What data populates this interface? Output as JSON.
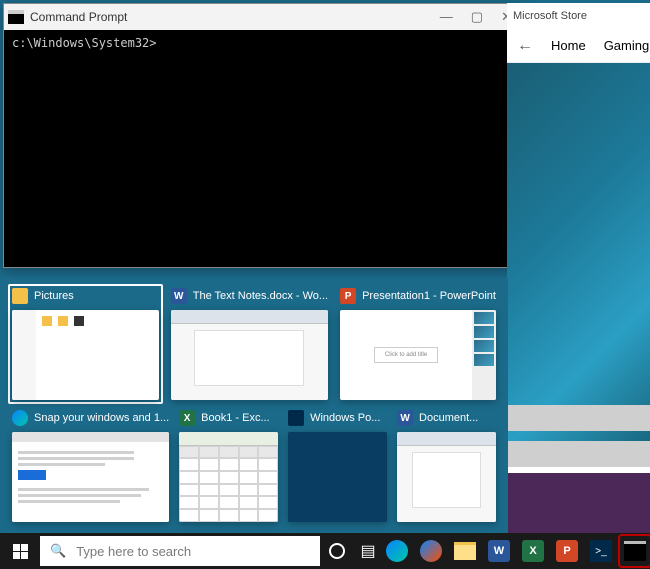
{
  "cmd": {
    "title": "Command Prompt",
    "prompt": "c:\\Windows\\System32>",
    "controls": {
      "min": "—",
      "max": "▢",
      "close": "✕"
    }
  },
  "store": {
    "title": "Microsoft Store",
    "back": "←",
    "nav": {
      "home": "Home",
      "gaming": "Gaming"
    }
  },
  "snap": {
    "row1": [
      {
        "label": "Pictures",
        "icon_name": "explorer-icon",
        "icon_bg": "#f5c04a",
        "kind": "explorer",
        "selected": true
      },
      {
        "label": "The Text Notes.docx - Wo...",
        "icon_name": "word-icon",
        "icon_bg": "#2b579a",
        "letter": "W",
        "kind": "word"
      },
      {
        "label": "Presentation1 - PowerPoint",
        "icon_name": "powerpoint-icon",
        "icon_bg": "#d24726",
        "letter": "P",
        "kind": "ppt",
        "slide_text": "Click to add title"
      }
    ],
    "row2": [
      {
        "label": "Snap your windows and 1...",
        "icon_name": "edge-icon",
        "icon_bg": "#0a84ff",
        "kind": "edge"
      },
      {
        "label": "Book1 - Exc...",
        "icon_name": "excel-icon",
        "icon_bg": "#217346",
        "letter": "X",
        "kind": "excel"
      },
      {
        "label": "Windows Po...",
        "icon_name": "powershell-icon",
        "icon_bg": "#012a4a",
        "kind": "ps"
      },
      {
        "label": "Document...",
        "icon_name": "word-icon",
        "icon_bg": "#2b579a",
        "letter": "W",
        "kind": "doc"
      }
    ]
  },
  "taskbar": {
    "search_placeholder": "Type here to search"
  }
}
